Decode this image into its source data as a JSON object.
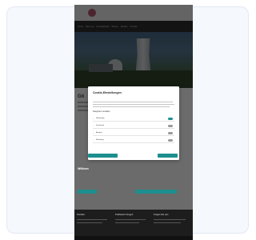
{
  "site": {
    "logo_text": "",
    "nav_items": [
      "Home",
      "Über uns",
      "Kernkraftwerk",
      "Wissen",
      "Medien",
      "Kontakt"
    ]
  },
  "page": {
    "heading": "Gö",
    "section_title": "Willkom"
  },
  "cookie_modal": {
    "title": "Cookie-Einstellungen",
    "description": "",
    "link": "",
    "subtitle": "Kategorien verwalten",
    "categories": [
      {
        "label": "Notwendig",
        "enabled": true
      },
      {
        "label": "Funktional",
        "enabled": false
      },
      {
        "label": "Analyse",
        "enabled": false
      },
      {
        "label": "Marketing",
        "enabled": false
      }
    ],
    "accept_selected": "",
    "accept_all": ""
  },
  "footer": {
    "col1": "Kontakt",
    "col2": "Kraftwerk Gösgen",
    "col3": "Folgen Sie uns"
  },
  "colors": {
    "accent": "#1d8f8f",
    "outer_bg": "#f5f8fd"
  }
}
